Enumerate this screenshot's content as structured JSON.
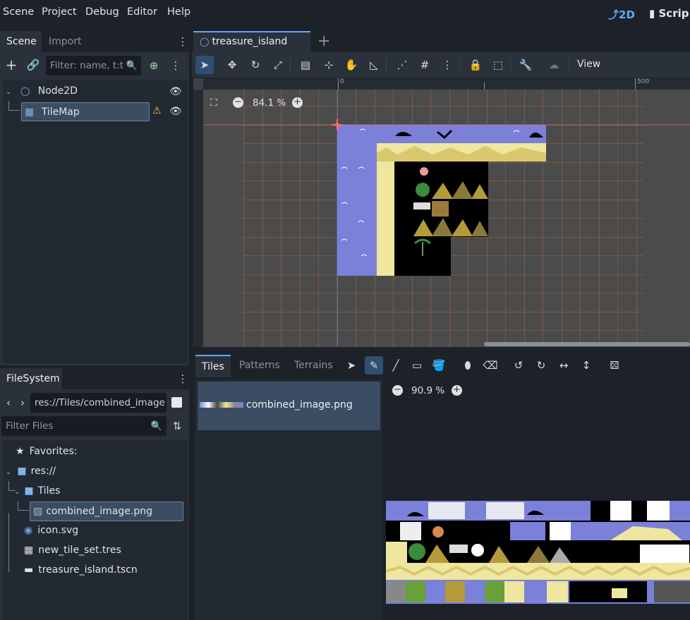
{
  "menu": [
    "Scene",
    "Project",
    "Debug",
    "Editor",
    "Help"
  ],
  "modes": {
    "two_d": "2D",
    "script": "Scrip"
  },
  "scene_dock": {
    "tabs": [
      "Scene",
      "Import"
    ],
    "filter_placeholder": "Filter: name, t:t",
    "tree": [
      {
        "label": "Node2D"
      },
      {
        "label": "TileMap"
      }
    ]
  },
  "filesystem": {
    "tab": "FileSystem",
    "path": "res://Tiles/combined_image",
    "filter_placeholder": "Filter Files",
    "tree": [
      "Favorites:",
      "res://",
      "Tiles",
      "combined_image.png",
      "icon.svg",
      "new_tile_set.tres",
      "treasure_island.tscn"
    ]
  },
  "editor": {
    "scene_tab": "treasure_island",
    "add_tab": "+",
    "view_menu": "View",
    "zoom": "84.1 %",
    "ruler": {
      "zero": "0",
      "five_hundred": "500"
    }
  },
  "tiles_panel": {
    "tabs": [
      "Tiles",
      "Patterns",
      "Terrains"
    ],
    "source_item": "combined_image.png",
    "zoom": "90.9 %"
  },
  "colors": {
    "accent": "#5fa9f8",
    "selection": "#3b4d63",
    "grid": "#c0673c",
    "water": "#7b80d8",
    "sand": "#efe6a0"
  }
}
